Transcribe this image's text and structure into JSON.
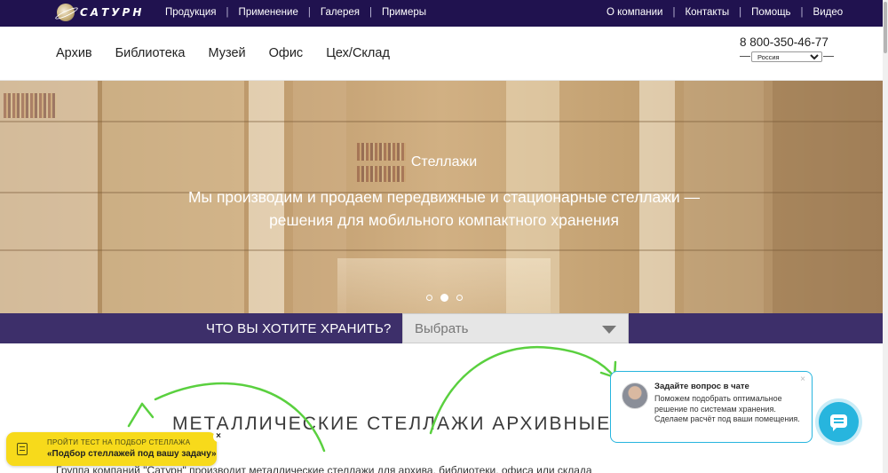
{
  "topbar": {
    "logo_text": "САТУРН",
    "left_links": [
      "Продукция",
      "Применение",
      "Галерея",
      "Примеры"
    ],
    "right_links": [
      "О компании",
      "Контакты",
      "Помощь",
      "Видео"
    ],
    "bg_color": "#20124f"
  },
  "mainnav": {
    "links": [
      "Архив",
      "Библиотека",
      "Музей",
      "Офис",
      "Цех/Склад"
    ],
    "phone": "8 800-350-46-77",
    "region": "Россия"
  },
  "hero": {
    "title": "Стеллажи",
    "text": "Мы производим и продаем передвижные и стационарные стеллажи — решения для мобильного компактного хранения",
    "slides_total": 3,
    "active_slide": 2
  },
  "search": {
    "label": "ЧТО ВЫ ХОТИТЕ ХРАНИТЬ?",
    "select_value": "Выбрать",
    "band_color": "#3d2f6a"
  },
  "content": {
    "heading": "МЕТАЛЛИЧЕСКИЕ СТЕЛЛАЖИ АРХИВНЫЕ И С",
    "paragraph": "Группа компаний \"Сатурн\" производит металлические стеллажи для архива, библиотеки, офиса или склада"
  },
  "quiz_badge": {
    "line1": "ПРОЙТИ ТЕСТ НА ПОДБОР СТЕЛЛАЖА",
    "line2": "«Подбор стеллажей под вашу задачу»",
    "close": "×",
    "color": "#f7da1b"
  },
  "chat": {
    "title": "Задайте вопрос в чате",
    "body": "Поможем подобрать оптимальное решение по системам хранения. Сделаем расчёт под ваши помещения.",
    "close": "×",
    "accent": "#27b5de"
  }
}
